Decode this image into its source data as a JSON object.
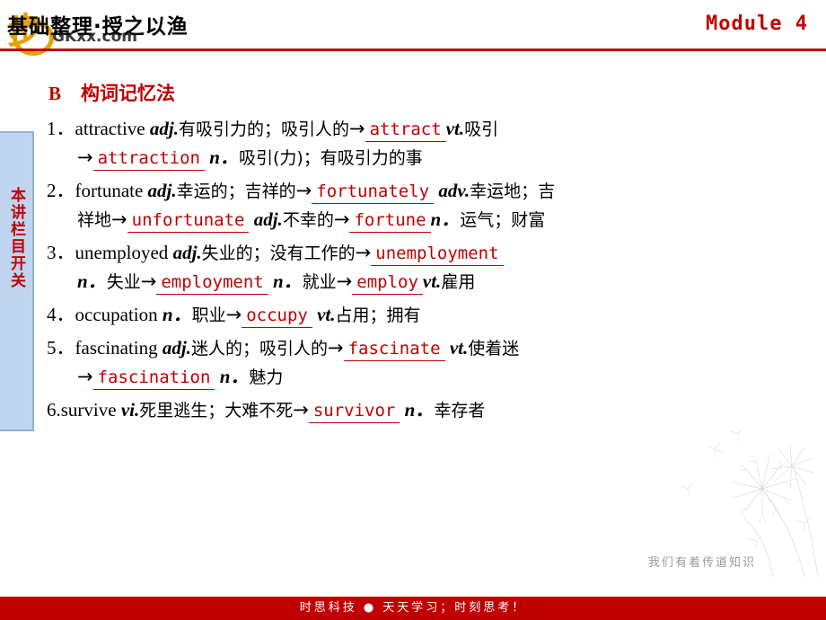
{
  "header": {
    "title": "基础整理·授之以渔",
    "module_label": "Module 4",
    "logo_char": "步",
    "logo_sub": "GKxx.com"
  },
  "sidebar": {
    "tab_text": "本讲栏目开关"
  },
  "section": {
    "letter": "B",
    "title": "构词记忆法"
  },
  "entries": [
    {
      "num": "1．",
      "line1": [
        {
          "t": "attractive ",
          "k": "eng"
        },
        {
          "t": "adj.",
          "k": "pos"
        },
        {
          "t": "有吸引力的；吸引人的",
          "k": "cn"
        },
        {
          "t": "→",
          "k": "arrow"
        },
        {
          "t": "attract",
          "k": "blank"
        },
        {
          "t": "vt.",
          "k": "pos"
        },
        {
          "t": "吸引",
          "k": "cn"
        }
      ],
      "line2": [
        {
          "t": "→",
          "k": "arrow"
        },
        {
          "t": "attraction ",
          "k": "blank"
        },
        {
          "t": " n．",
          "k": "pos"
        },
        {
          "t": "吸引(力)；有吸引力的事",
          "k": "cn"
        }
      ]
    },
    {
      "num": "2．",
      "line1": [
        {
          "t": "fortunate ",
          "k": "eng"
        },
        {
          "t": "adj.",
          "k": "pos"
        },
        {
          "t": "幸运的；吉祥的",
          "k": "cn"
        },
        {
          "t": "→",
          "k": "arrow"
        },
        {
          "t": "fortunately",
          "k": "blank"
        },
        {
          "t": " adv.",
          "k": "pos"
        },
        {
          "t": "幸运地；吉",
          "k": "cn"
        }
      ],
      "line2": [
        {
          "t": "祥地",
          "k": "cn"
        },
        {
          "t": "→",
          "k": "arrow"
        },
        {
          "t": "unfortunate ",
          "k": "blank"
        },
        {
          "t": " adj.",
          "k": "pos"
        },
        {
          "t": "不幸的",
          "k": "cn"
        },
        {
          "t": "→",
          "k": "arrow"
        },
        {
          "t": " fortune",
          "k": "blank"
        },
        {
          "t": "n．",
          "k": "pos"
        },
        {
          "t": "运气；财富",
          "k": "cn"
        }
      ]
    },
    {
      "num": "3．",
      "line1": [
        {
          "t": "unemployed ",
          "k": "eng"
        },
        {
          "t": "adj.",
          "k": "pos"
        },
        {
          "t": "失业的；没有工作的",
          "k": "cn"
        },
        {
          "t": "→",
          "k": "arrow"
        },
        {
          "t": " unemployment ",
          "k": "blank"
        }
      ],
      "line2": [
        {
          "t": "n．",
          "k": "pos"
        },
        {
          "t": "失业",
          "k": "cn"
        },
        {
          "t": "→",
          "k": "arrow"
        },
        {
          "t": " employment ",
          "k": "blank"
        },
        {
          "t": " n．",
          "k": "pos"
        },
        {
          "t": "就业",
          "k": "cn"
        },
        {
          "t": "→",
          "k": "arrow"
        },
        {
          "t": " employ",
          "k": "blank"
        },
        {
          "t": "vt.",
          "k": "pos"
        },
        {
          "t": "雇用",
          "k": "cn"
        }
      ]
    },
    {
      "num": "4．",
      "line1": [
        {
          "t": "occupation ",
          "k": "eng"
        },
        {
          "t": "n．",
          "k": "pos"
        },
        {
          "t": "职业",
          "k": "cn"
        },
        {
          "t": "→",
          "k": "arrow"
        },
        {
          "t": " occupy ",
          "k": "blank"
        },
        {
          "t": " vt.",
          "k": "pos"
        },
        {
          "t": "占用；拥有",
          "k": "cn"
        }
      ],
      "line2": []
    },
    {
      "num": "5．",
      "line1": [
        {
          "t": "fascinating ",
          "k": "eng"
        },
        {
          "t": "adj.",
          "k": "pos"
        },
        {
          "t": "迷人的；吸引人的",
          "k": "cn"
        },
        {
          "t": "→",
          "k": "arrow"
        },
        {
          "t": "fascinate ",
          "k": "blank"
        },
        {
          "t": " vt.",
          "k": "pos"
        },
        {
          "t": "使着迷",
          "k": "cn"
        }
      ],
      "line2": [
        {
          "t": "→",
          "k": "arrow"
        },
        {
          "t": "fascination ",
          "k": "blank"
        },
        {
          "t": " n．",
          "k": "pos"
        },
        {
          "t": "魅力",
          "k": "cn"
        }
      ]
    },
    {
      "num": "6.",
      "line1": [
        {
          "t": "survive ",
          "k": "eng"
        },
        {
          "t": "vi.",
          "k": "pos"
        },
        {
          "t": "死里逃生；大难不死",
          "k": "cn"
        },
        {
          "t": "→",
          "k": "arrow"
        },
        {
          "t": " survivor ",
          "k": "blank"
        },
        {
          "t": " n．",
          "k": "pos"
        },
        {
          "t": "幸存者",
          "k": "cn"
        }
      ],
      "line2": []
    }
  ],
  "footer": {
    "text": "时思科技 ● 天天学习；时刻思考！",
    "watermark": "我们有着传道知识"
  },
  "colors": {
    "accent_red": "#c00000",
    "tab_blue": "#bfd4ef",
    "logo_orange": "#e8a000"
  }
}
